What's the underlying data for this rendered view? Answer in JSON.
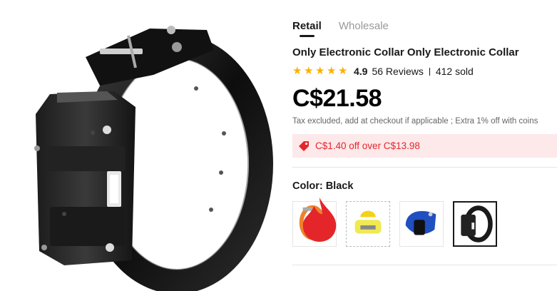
{
  "tabs": [
    {
      "label": "Retail",
      "active": true
    },
    {
      "label": "Wholesale",
      "active": false
    }
  ],
  "product": {
    "title": "Only Electronic Collar Only Electronic Collar",
    "rating": "4.9",
    "stars": 5,
    "reviews": "56 Reviews",
    "sold": "412 sold",
    "price": "C$21.58",
    "tax_note": "Tax excluded, add at checkout if applicable ; Extra 1% off with coins"
  },
  "coupon": {
    "text": "C$1.40 off over C$13.98",
    "icon": "tag-icon",
    "color": "#e4262a",
    "background": "#fde8ea"
  },
  "color_selector": {
    "label": "Color: Black",
    "options": [
      {
        "name": "orange collar",
        "color": "#f0822c",
        "hot": true,
        "selected": false
      },
      {
        "name": "yellow receiver",
        "color": "#f4e13a",
        "hot": false,
        "selected": false
      },
      {
        "name": "blue collar",
        "color": "#1f4fc0",
        "hot": false,
        "selected": false
      },
      {
        "name": "black collar",
        "color": "#1a1a1a",
        "hot": false,
        "selected": true
      }
    ]
  },
  "colors": {
    "star": "#fdb000",
    "accent_red": "#e4262a",
    "text": "#191919"
  }
}
